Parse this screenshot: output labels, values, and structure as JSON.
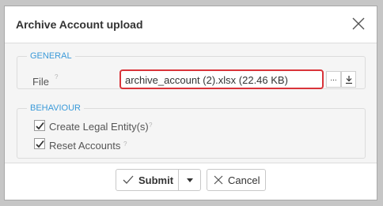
{
  "dialog": {
    "title": "Archive Account upload"
  },
  "general": {
    "legend": "GENERAL",
    "file_label": "File",
    "file_help": "?",
    "file_value": "archive_account (2).xlsx (22.46 KB)",
    "browse_label": "...",
    "download_icon": "download-icon"
  },
  "behaviour": {
    "legend": "BEHAVIOUR",
    "options": [
      {
        "label": "Create Legal Entity(s)",
        "help": "?",
        "checked": true
      },
      {
        "label": "Reset Accounts",
        "help": "?",
        "checked": true
      }
    ]
  },
  "footer": {
    "submit_label": "Submit",
    "cancel_label": "Cancel"
  },
  "colors": {
    "accent": "#3b9ad9",
    "error_border": "#d9343a"
  }
}
